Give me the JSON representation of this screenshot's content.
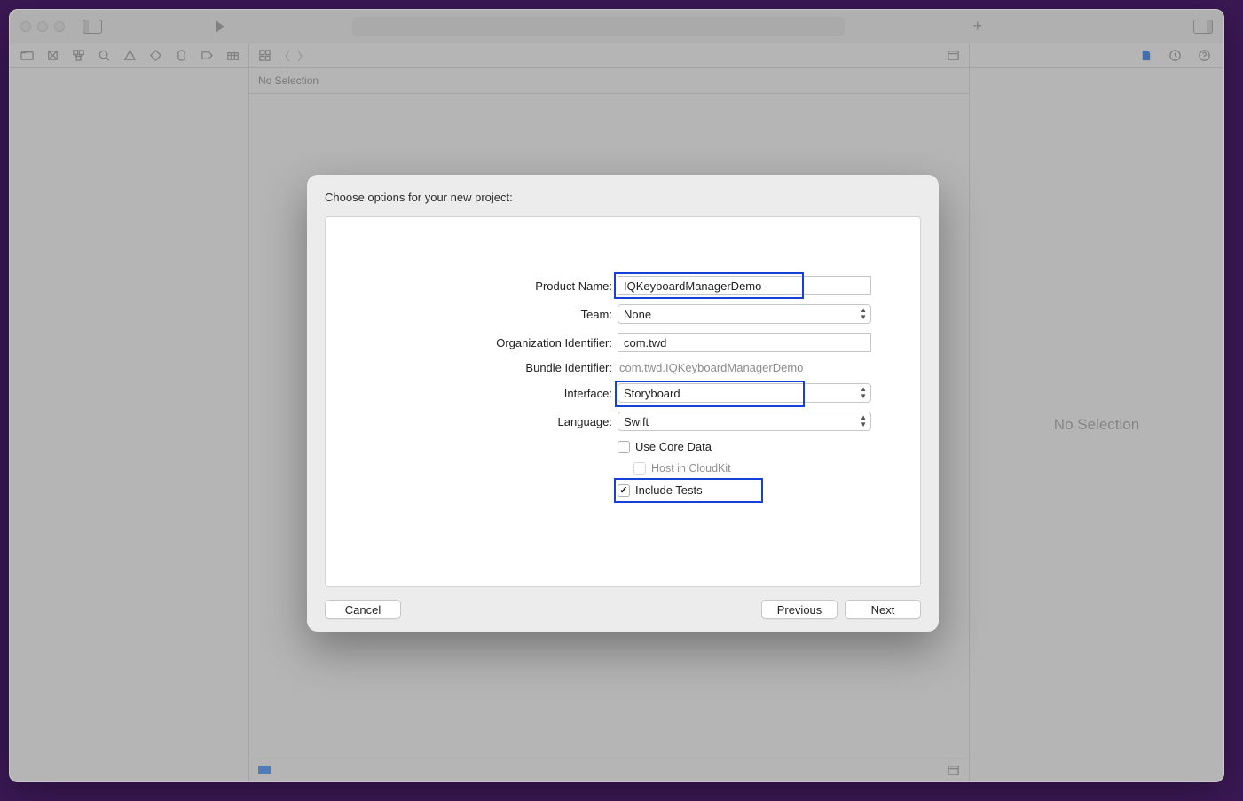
{
  "editor": {
    "no_selection_bar": "No Selection",
    "inspector_placeholder": "No Selection"
  },
  "modal": {
    "title": "Choose options for your new project:",
    "labels": {
      "product_name": "Product Name:",
      "team": "Team:",
      "org_identifier": "Organization Identifier:",
      "bundle_identifier": "Bundle Identifier:",
      "interface": "Interface:",
      "language": "Language:"
    },
    "values": {
      "product_name": "IQKeyboardManagerDemo",
      "team": "None",
      "org_identifier": "com.twd",
      "bundle_identifier": "com.twd.IQKeyboardManagerDemo",
      "interface": "Storyboard",
      "language": "Swift"
    },
    "checkboxes": {
      "use_core_data": {
        "label": "Use Core Data",
        "checked": false
      },
      "host_cloudkit": {
        "label": "Host in CloudKit",
        "checked": false,
        "enabled": false
      },
      "include_tests": {
        "label": "Include Tests",
        "checked": true
      }
    },
    "buttons": {
      "cancel": "Cancel",
      "previous": "Previous",
      "next": "Next"
    }
  }
}
